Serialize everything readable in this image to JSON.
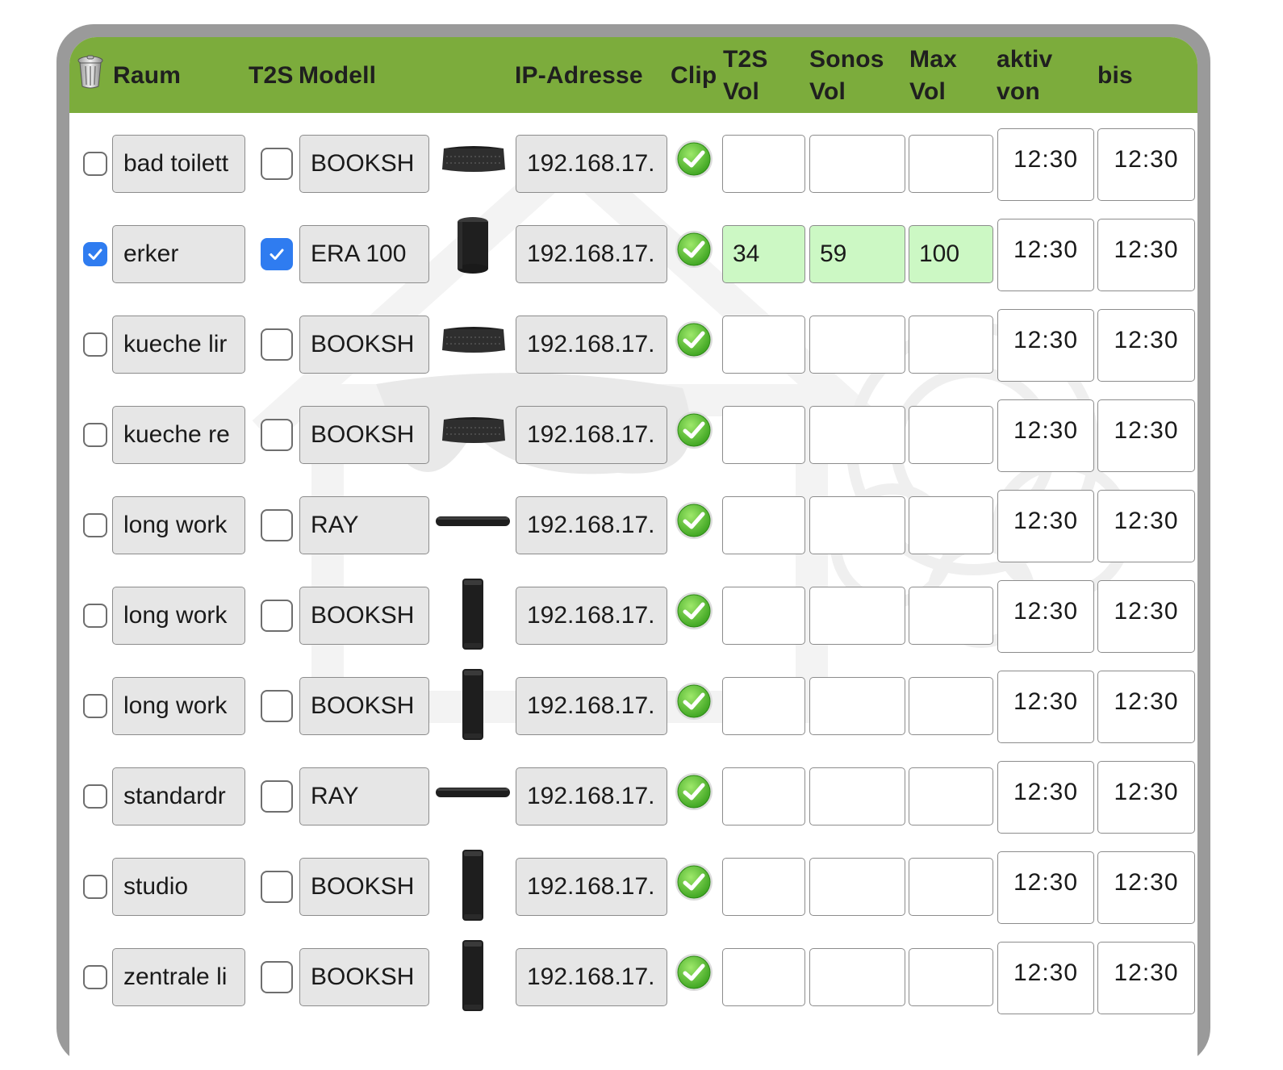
{
  "header": {
    "raum": "Raum",
    "t2s": "T2S",
    "modell": "Modell",
    "ip": "IP-Adresse",
    "clip": "Clip",
    "t2s_vol": [
      "T2S",
      "Vol"
    ],
    "sonos_vol": [
      "Sonos",
      "Vol"
    ],
    "max_vol": [
      "Max",
      "Vol"
    ],
    "aktiv_von": [
      "aktiv",
      "von"
    ],
    "bis": "bis"
  },
  "colors": {
    "header_green": "#7cac3c",
    "checkbox_blue": "#2f7cf0",
    "filled_input_green": "#ccf8c4",
    "frame_gray": "#9a9a9a"
  },
  "rows": [
    {
      "room": "bad toilett",
      "selected": false,
      "t2s": false,
      "model": "BOOKSH",
      "icon": "bookshelf-speaker-icon",
      "ip": "192.168.17.",
      "t2s_vol": "",
      "sonos_vol": "",
      "max_vol": "",
      "von": "12:30",
      "bis": "12:30"
    },
    {
      "room": "erker",
      "selected": true,
      "t2s": true,
      "model": "ERA 100",
      "icon": "era100-speaker-icon",
      "ip": "192.168.17.",
      "t2s_vol": "34",
      "sonos_vol": "59",
      "max_vol": "100",
      "von": "12:30",
      "bis": "12:30"
    },
    {
      "room": "kueche lir",
      "selected": false,
      "t2s": false,
      "model": "BOOKSH",
      "icon": "bookshelf-speaker-icon",
      "ip": "192.168.17.",
      "t2s_vol": "",
      "sonos_vol": "",
      "max_vol": "",
      "von": "12:30",
      "bis": "12:30"
    },
    {
      "room": "kueche re",
      "selected": false,
      "t2s": false,
      "model": "BOOKSH",
      "icon": "bookshelf-speaker-icon",
      "ip": "192.168.17.",
      "t2s_vol": "",
      "sonos_vol": "",
      "max_vol": "",
      "von": "12:30",
      "bis": "12:30"
    },
    {
      "room": "long work",
      "selected": false,
      "t2s": false,
      "model": "RAY",
      "icon": "soundbar-icon",
      "ip": "192.168.17.",
      "t2s_vol": "",
      "sonos_vol": "",
      "max_vol": "",
      "von": "12:30",
      "bis": "12:30"
    },
    {
      "room": "long work",
      "selected": false,
      "t2s": false,
      "model": "BOOKSH",
      "icon": "upright-speaker-icon",
      "ip": "192.168.17.",
      "t2s_vol": "",
      "sonos_vol": "",
      "max_vol": "",
      "von": "12:30",
      "bis": "12:30"
    },
    {
      "room": "long work",
      "selected": false,
      "t2s": false,
      "model": "BOOKSH",
      "icon": "upright-speaker-icon",
      "ip": "192.168.17.",
      "t2s_vol": "",
      "sonos_vol": "",
      "max_vol": "",
      "von": "12:30",
      "bis": "12:30"
    },
    {
      "room": "standardr",
      "selected": false,
      "t2s": false,
      "model": "RAY",
      "icon": "soundbar-icon",
      "ip": "192.168.17.",
      "t2s_vol": "",
      "sonos_vol": "",
      "max_vol": "",
      "von": "12:30",
      "bis": "12:30"
    },
    {
      "room": "studio",
      "selected": false,
      "t2s": false,
      "model": "BOOKSH",
      "icon": "upright-speaker-icon",
      "ip": "192.168.17.",
      "t2s_vol": "",
      "sonos_vol": "",
      "max_vol": "",
      "von": "12:30",
      "bis": "12:30"
    },
    {
      "room": "zentrale li",
      "selected": false,
      "t2s": false,
      "model": "BOOKSH",
      "icon": "upright-speaker-icon",
      "ip": "192.168.17.",
      "t2s_vol": "",
      "sonos_vol": "",
      "max_vol": "",
      "von": "12:30",
      "bis": "12:30"
    }
  ]
}
